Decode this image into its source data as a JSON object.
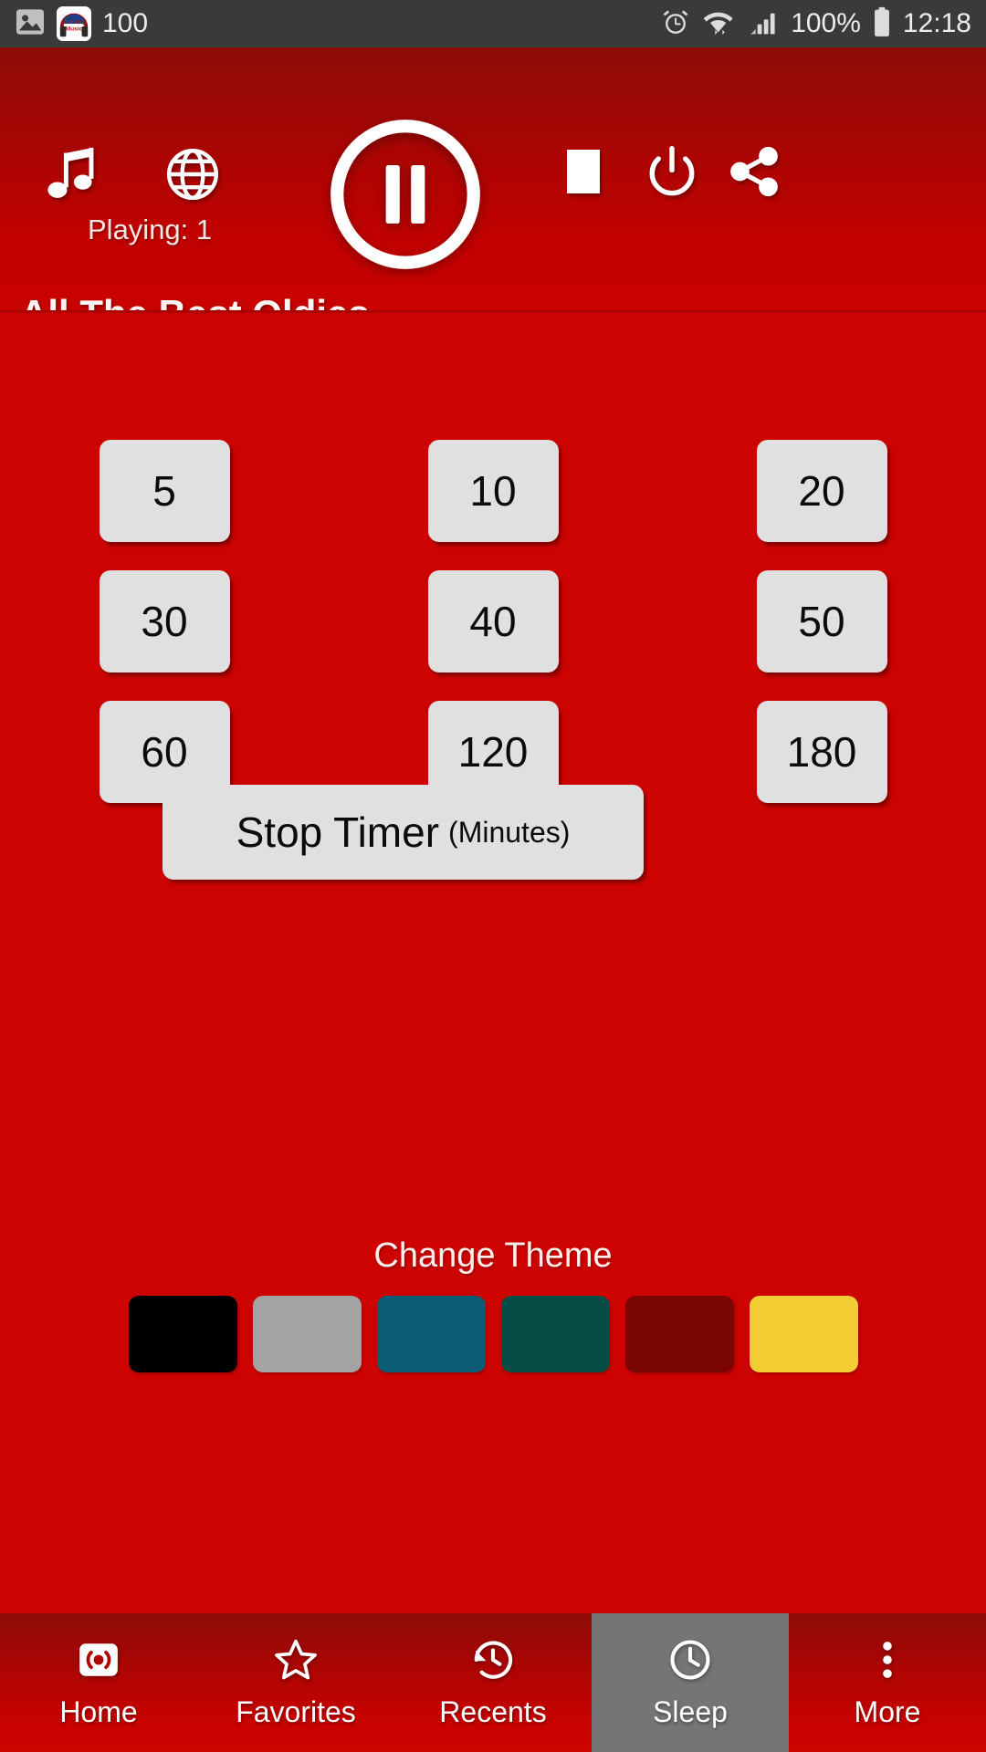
{
  "status_bar": {
    "left_icons": [
      {
        "name": "image-icon",
        "glyph": "picture"
      },
      {
        "name": "app-notification-icon",
        "glyph": "nonstop-music"
      }
    ],
    "notification_count": "100",
    "right_icons": [
      {
        "name": "alarm-icon"
      },
      {
        "name": "wifi-icon"
      },
      {
        "name": "signal-icon"
      },
      {
        "name": "battery-icon"
      }
    ],
    "battery_percent": "100%",
    "time": "12:18"
  },
  "header": {
    "music_icon": "music-note-icon",
    "globe_icon": "globe-icon",
    "play_pause_icon": "pause-icon",
    "stop_icon": "stop-icon",
    "power_icon": "power-icon",
    "share_icon": "share-icon",
    "playing_label": "Playing: 1",
    "station_title": "All The Best Oldies"
  },
  "main": {
    "timer_buttons": [
      "5",
      "10",
      "20",
      "30",
      "40",
      "50",
      "60",
      "120",
      "180"
    ],
    "stop_timer": {
      "main_label": "Stop Timer",
      "sub_label": "(Minutes)"
    },
    "change_theme_label": "Change Theme",
    "themes": [
      {
        "name": "theme-black",
        "color": "#000000"
      },
      {
        "name": "theme-gray",
        "color": "#A3A3A3"
      },
      {
        "name": "theme-blue",
        "color": "#0A5B73"
      },
      {
        "name": "theme-green",
        "color": "#064E45"
      },
      {
        "name": "theme-maroon",
        "color": "#7A0505"
      },
      {
        "name": "theme-yellow",
        "color": "#F2CE34"
      }
    ]
  },
  "bottom_nav": {
    "active_index": 3,
    "items": [
      {
        "label": "Home",
        "icon": "broadcast-icon"
      },
      {
        "label": "Favorites",
        "icon": "star-icon"
      },
      {
        "label": "Recents",
        "icon": "history-icon"
      },
      {
        "label": "Sleep",
        "icon": "clock-icon"
      },
      {
        "label": "More",
        "icon": "overflow-menu-icon"
      }
    ]
  },
  "colors": {
    "body_red": "#CC0300",
    "header_dark_red": "#8C0C08",
    "status_bar": "#3A3A3A",
    "button_gray": "#E0E0E0",
    "active_nav_gray": "#757575"
  }
}
